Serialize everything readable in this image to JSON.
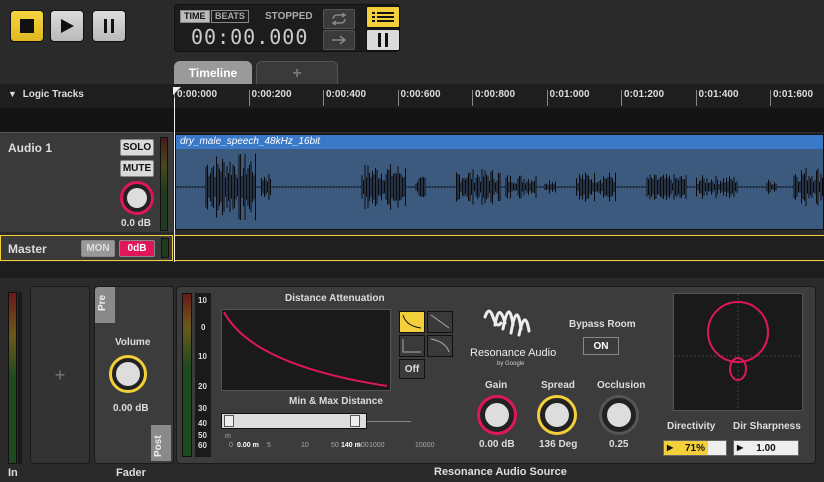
{
  "transport": {
    "time_tag": "TIME",
    "beats_tag": "BEATS",
    "status": "STOPPED",
    "time": "00:00.000"
  },
  "tabs": {
    "timeline": "Timeline",
    "add": "+"
  },
  "tracks_header": "Logic Tracks",
  "ruler": [
    "0:00:000",
    "0:00:200",
    "0:00:400",
    "0:00:600",
    "0:00:800",
    "0:01:000",
    "0:01:200",
    "0:01:400",
    "0:01:600"
  ],
  "audio_track": {
    "name": "Audio 1",
    "solo": "SOLO",
    "mute": "MUTE",
    "gain": "0.0 dB",
    "clip_name": "dry_male_speech_48kHz_16bit"
  },
  "master_track": {
    "name": "Master",
    "mon": "MON",
    "gain": "0dB"
  },
  "mixer": {
    "in_label": "In",
    "fader_label": "Fader",
    "add": "+",
    "pre": "Pre",
    "post": "Post",
    "volume_label": "Volume",
    "volume_value": "0.00 dB"
  },
  "plugin": {
    "title": "Resonance Audio Source",
    "meter_scale": [
      "10",
      "0",
      "10",
      "20",
      "30",
      "40",
      "50",
      "60"
    ],
    "distance_attenuation": "Distance Attenuation",
    "off": "Off",
    "min_max_distance": "Min & Max Distance",
    "distance_unit": "m",
    "distance_scale": [
      "0",
      "5",
      "10",
      "50",
      "100",
      "1000",
      "10000"
    ],
    "min_distance": "0.00 m",
    "max_distance": "140 m",
    "brand": "Resonance Audio",
    "brand_sub": "by Google",
    "bypass_room_label": "Bypass Room",
    "bypass_room_value": "ON",
    "gain_label": "Gain",
    "gain_value": "0.00 dB",
    "spread_label": "Spread",
    "spread_value": "136 Deg",
    "occlusion_label": "Occlusion",
    "occlusion_value": "0.25",
    "directivity_label": "Directivity",
    "directivity_value": "71%",
    "directivity_level": 0.71,
    "dir_sharpness_label": "Dir Sharpness",
    "dir_sharpness_value": "1.00"
  },
  "colors": {
    "accent": "#f3d03a",
    "pink": "#e0165a",
    "clip": "#3a78c8"
  }
}
